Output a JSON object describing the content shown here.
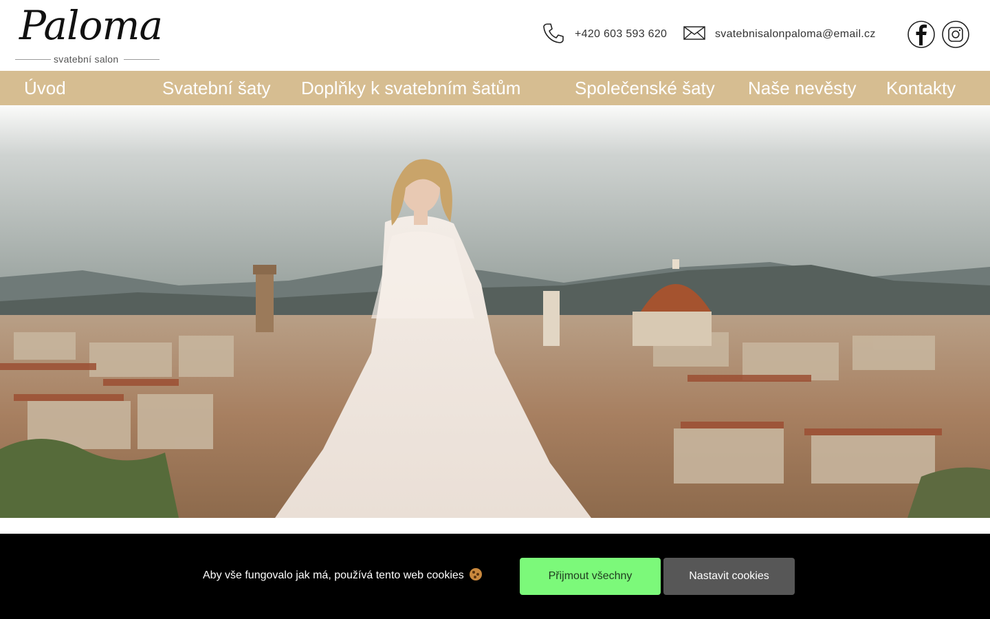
{
  "logo": {
    "script": "Paloma",
    "subtitle": "svatební salon"
  },
  "contact": {
    "phone": "+420 603 593 620",
    "email": "svatebnisalonpaloma@email.cz",
    "phone_icon": "phone-icon",
    "email_icon": "mail-icon"
  },
  "social": {
    "facebook_icon": "facebook-icon",
    "instagram_icon": "instagram-icon"
  },
  "nav": {
    "items": [
      {
        "label": "Úvod"
      },
      {
        "label": "Svatební šaty"
      },
      {
        "label": "Doplňky k svatebním šatům"
      },
      {
        "label": "Společenské šaty"
      },
      {
        "label": "Naše nevěsty"
      },
      {
        "label": "Kontakty"
      }
    ]
  },
  "cookie_bar": {
    "message": "Aby vše fungovalo jak má, používá tento web cookies",
    "accept_label": "Přijmout všechny",
    "settings_label": "Nastavit cookies"
  },
  "colors": {
    "nav_background": "#d6bd91",
    "accept_button": "#7cf97a",
    "settings_button": "#575757",
    "cookie_bar": "#000000"
  }
}
